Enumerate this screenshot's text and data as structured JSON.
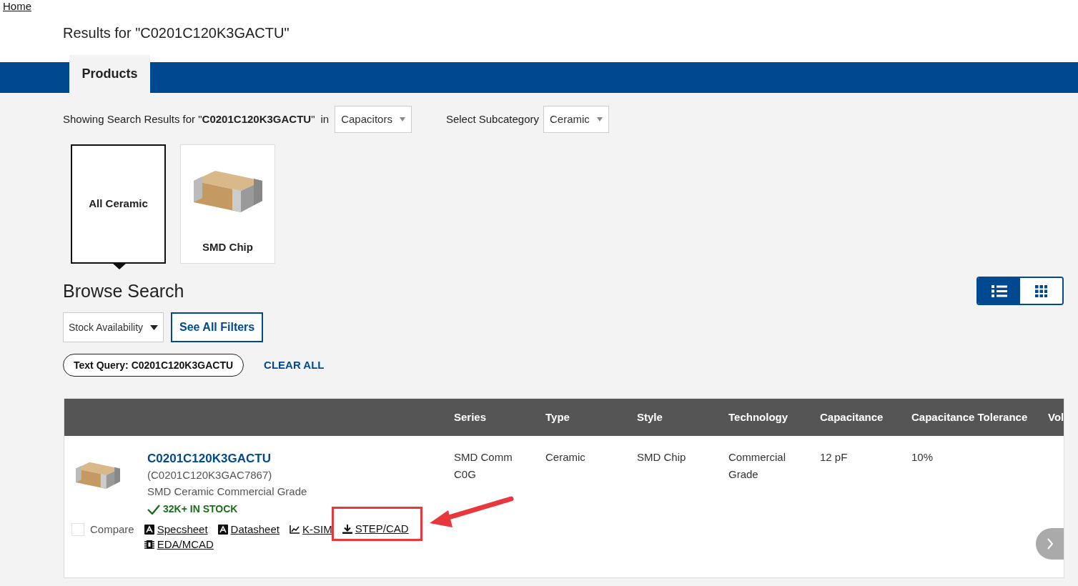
{
  "breadcrumb": {
    "label": "Home"
  },
  "page_title": "Results for \"C0201C120K3GACTU\"",
  "tabs": [
    {
      "label": "Products",
      "selected": true
    }
  ],
  "search_summary": {
    "text": "Showing Search Results for \"**C0201C120K3GACTU**\"",
    "in_label": "in",
    "category": "Capacitors",
    "subcategory_label": "Select Subcategory",
    "subcategory": "Ceramic"
  },
  "category_tiles": [
    {
      "label": "All Ceramic",
      "selected": true,
      "kind": "text"
    },
    {
      "label": "SMD Chip",
      "selected": false,
      "kind": "image"
    }
  ],
  "browse": {
    "title": "Browse Search",
    "views": [
      {
        "kind": "list",
        "selected": true
      },
      {
        "kind": "grid",
        "selected": false
      }
    ]
  },
  "filters": {
    "stock": "Stock Availability",
    "see_all": "See All Filters"
  },
  "active_filters": [
    {
      "label": "Text Query: C0201C120K3GACTU"
    }
  ],
  "clear_all": "CLEAR ALL",
  "table": {
    "columns": [
      "Series",
      "Type",
      "Style",
      "Technology",
      "Capacitance",
      "Capacitance Tolerance",
      "Vol"
    ],
    "rows": [
      {
        "part": "C0201C120K3GACTU",
        "alt_part": "(C0201C120K3GAC7867)",
        "description": "SMD Ceramic Commercial Grade",
        "stock": "32K+ IN STOCK",
        "compare": {
          "label": "Compare",
          "checked": false
        },
        "links": [
          {
            "label": "Specsheet",
            "kind": "pdf",
            "highlighted": false
          },
          {
            "label": "Datasheet",
            "kind": "pdf",
            "highlighted": false
          },
          {
            "label": "K-SIM",
            "kind": "chart",
            "highlighted": false
          },
          {
            "label": "STEP/CAD",
            "kind": "download",
            "highlighted": true
          },
          {
            "label": "EDA/MCAD",
            "kind": "chip",
            "highlighted": false
          }
        ],
        "cells": [
          "SMD Comm C0G",
          "Ceramic",
          "SMD Chip",
          "Commercial Grade",
          "12 pF",
          "10%",
          ""
        ]
      }
    ]
  }
}
